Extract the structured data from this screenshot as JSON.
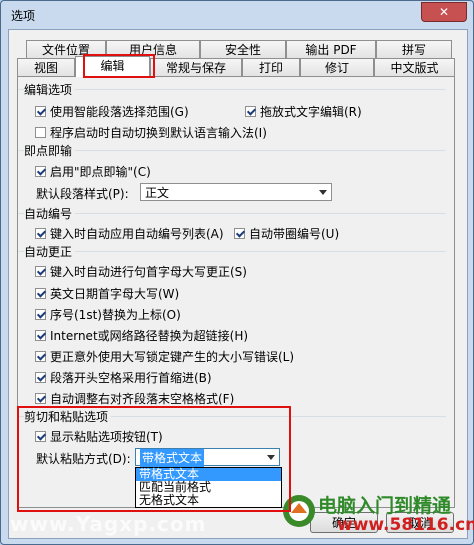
{
  "window": {
    "title": "选项",
    "close_glyph": "✕"
  },
  "tabs_row1": [
    "文件位置",
    "用户信息",
    "安全性",
    "输出 PDF",
    "拼写"
  ],
  "tabs_row2": [
    "视图",
    "编辑",
    "常规与保存",
    "打印",
    "修订",
    "中文版式"
  ],
  "active_tab": "编辑",
  "sections": {
    "edit": {
      "title": "编辑选项",
      "smart_select": "使用智能段落选择范围(G)",
      "drag_drop": "拖放式文字编辑(R)",
      "auto_ime": "程序启动时自动切换到默认语言输入法(I)"
    },
    "click_type": {
      "title": "即点即输",
      "enable": "启用\"即点即输\"(C)",
      "para_style_label": "默认段落样式(P):",
      "para_style_value": "正文"
    },
    "numbering": {
      "title": "自动编号",
      "auto_list": "键入时自动应用自动编号列表(A)",
      "auto_circle": "自动带圈编号(U)"
    },
    "autocorrect": {
      "title": "自动更正",
      "items": [
        "键入时自动进行句首字母大写更正(S)",
        "英文日期首字母大写(W)",
        "序号(1st)替换为上标(O)",
        "Internet或网络路径替换为超链接(H)",
        "更正意外使用大写锁定键产生的大小写错误(L)",
        "段落开头空格采用行首缩进(B)",
        "自动调整右对齐段落末空格格式(F)"
      ]
    },
    "paste": {
      "title": "剪切和粘贴选项",
      "show_button": "显示粘贴选项按钮(T)",
      "default_label": "默认粘贴方式(D):",
      "default_value": "带格式文本",
      "options": [
        "带格式文本",
        "匹配当前格式",
        "无格式文本"
      ]
    }
  },
  "buttons": {
    "ok": "确定",
    "cancel": "取消"
  },
  "watermarks": {
    "left": "www.Yagxp.com",
    "right_top": "电脑入门到精通",
    "right_bottom": "www.58116.cn"
  }
}
